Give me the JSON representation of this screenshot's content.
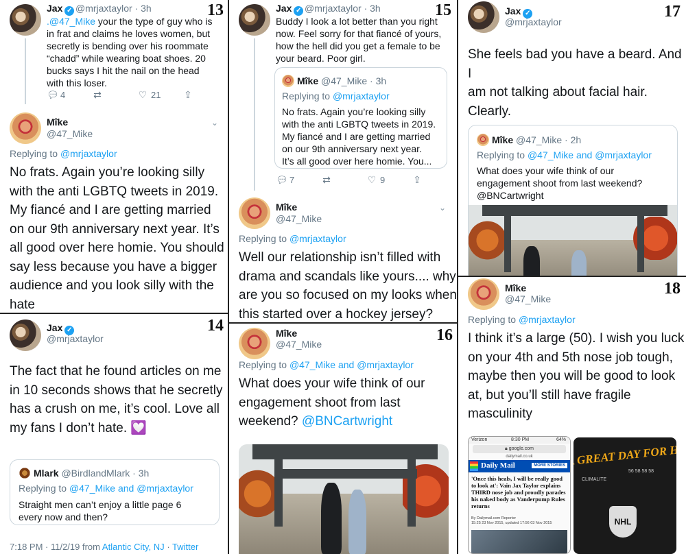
{
  "panels": {
    "p13": {
      "number": "13",
      "top_tweet": {
        "name": "Jax",
        "handle": "@mrjaxtaylor",
        "time": "· 3h",
        "lines": [
          ".@47_Mike your the type of guy who is",
          "in frat and claims he loves women, but",
          "secretly is bending over his roommate",
          "“chadd” while wearing boat shoes. 20",
          "bucks says I hit the nail on the head",
          "with this loser."
        ],
        "replies": "4",
        "likes": "21"
      },
      "reply": {
        "name": "Mîke",
        "handle": "@47_Mike",
        "replying_prefix": "Replying to",
        "replying_to": "@mrjaxtaylor",
        "lines": [
          "No frats. Again you’re looking silly",
          "with the anti LGBTQ tweets in 2019.",
          "My fiancé and I are getting married",
          "on our 9th anniversary next year. It’s",
          "all good over here homie. You should",
          "say less because you have a bigger",
          "audience and you look silly with the",
          "hate"
        ]
      }
    },
    "p14": {
      "number": "14",
      "name": "Jax",
      "handle": "@mrjaxtaylor",
      "lines": [
        "The fact that he found articles on me",
        "in 10 seconds shows that he secretly",
        "has a crush on me, it’s cool. Love all",
        "my fans I don’t hate."
      ],
      "emoji": "💟",
      "quote": {
        "name": "Mlark",
        "handle": "@BirdlandMlark",
        "time": "· 3h",
        "replying_prefix": "Replying to",
        "replying_to": "@47_Mike and @mrjaxtaylor",
        "lines": [
          "Straight men can’t enjoy a little page 6",
          "every now and then?"
        ]
      },
      "footer_time": "7:18 PM · 11/2/19 from",
      "footer_place": "Atlantic City, NJ",
      "footer_sep": "·",
      "footer_source": "Twitter"
    },
    "p15": {
      "number": "15",
      "top_tweet": {
        "name": "Jax",
        "handle": "@mrjaxtaylor",
        "time": "· 3h",
        "lines": [
          "Buddy I look a lot better than you right",
          "now. Feel sorry for that fiancé of yours,",
          "how the hell did you get a female to be",
          "your beard. Poor girl."
        ],
        "quote": {
          "name": "Mîke",
          "handle": "@47_Mike",
          "time": "· 3h",
          "replying_prefix": "Replying to",
          "replying_to": "@mrjaxtaylor",
          "lines": [
            "No frats. Again you’re looking silly",
            "with the anti LGBTQ tweets in 2019.",
            "My fiancé and I are getting married",
            "on our 9th anniversary next year.",
            "It’s all good over here homie. You..."
          ]
        },
        "replies": "7",
        "likes": "9"
      },
      "reply": {
        "name": "Mîke",
        "handle": "@47_Mike",
        "replying_prefix": "Replying to",
        "replying_to": "@mrjaxtaylor",
        "lines": [
          "Well our relationship isn’t filled with",
          "drama and scandals like yours.... why",
          "are you so focused on my looks when",
          "this started over a hockey jersey?"
        ]
      }
    },
    "p16": {
      "number": "16",
      "name": "Mîke",
      "handle": "@47_Mike",
      "replying_prefix": "Replying to",
      "replying_to": "@47_Mike and @mrjaxtaylor",
      "lines": [
        "What does your wife think of our",
        "engagement shoot from last"
      ],
      "last_line_prefix": "weekend?",
      "mention": "@BNCartwright"
    },
    "p17": {
      "number": "17",
      "name": "Jax",
      "handle": "@mrjaxtaylor",
      "lines": [
        "She feels bad you have a beard. And I",
        "am not talking about facial hair.",
        "Clearly."
      ],
      "quote": {
        "name": "Mîke",
        "handle": "@47_Mike",
        "time": "· 2h",
        "replying_prefix": "Replying to",
        "replying_to": "@47_Mike and @mrjaxtaylor",
        "lines": [
          "What does your wife think of our",
          "engagement shoot from last weekend?",
          "@BNCartwright"
        ]
      }
    },
    "p18": {
      "number": "18",
      "name": "Mîke",
      "handle": "@47_Mike",
      "replying_prefix": "Replying to",
      "replying_to": "@mrjaxtaylor",
      "lines": [
        "I think it’s a large (50). I wish you luck",
        "on your 4th and 5th nose job tough,",
        "maybe then you will be good to look",
        "at, but you’ll still have fragile",
        "masculinity"
      ],
      "phone": {
        "carrier": "Verizon",
        "time": "8:30 PM",
        "battery": "64%",
        "url": "google.com",
        "site": "dailymail.co.uk",
        "brand": "Daily Mail",
        "more": "MORE STORIES",
        "headline": "'Once this heals, I will be really good to look at': Vain Jax Taylor explains THIRD nose job and proudly parades his naked body as Vanderpump Rules returns",
        "byline": "By Dailymail.com Reporter",
        "dates": "15:25 23 Nov 2015, updated 17:56 03 Nov 2015"
      },
      "jersey": {
        "slogan": "A GREAT DAY FOR HOCKEY",
        "brand": "CLIMALITE",
        "league": "NHL",
        "size": "56 58 58 58"
      }
    }
  },
  "colors": {
    "link": "#1da1f2",
    "muted": "#657786",
    "text": "#14171a",
    "divider": "#222222"
  }
}
